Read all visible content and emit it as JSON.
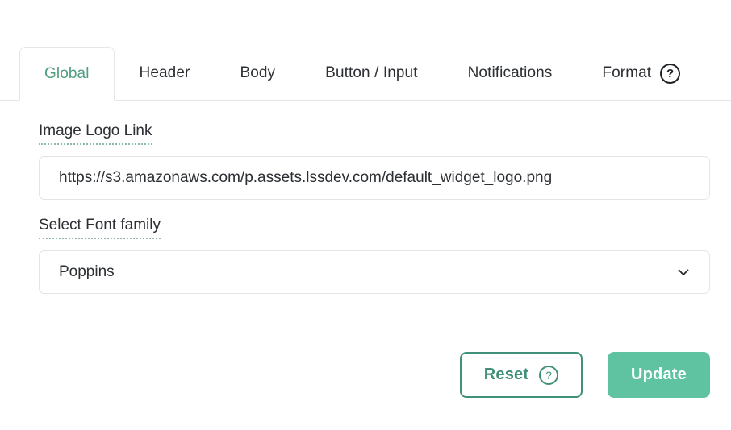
{
  "tabs": {
    "items": [
      {
        "label": "Global",
        "active": true
      },
      {
        "label": "Header",
        "active": false
      },
      {
        "label": "Body",
        "active": false
      },
      {
        "label": "Button / Input",
        "active": false
      },
      {
        "label": "Notifications",
        "active": false
      },
      {
        "label": "Format",
        "active": false
      }
    ],
    "help_icon": "question-mark-circle-icon",
    "help_glyph": "?"
  },
  "form": {
    "logo": {
      "label": "Image Logo Link",
      "value": "https://s3.amazonaws.com/p.assets.lssdev.com/default_widget_logo.png",
      "placeholder": "https://s3.amazonaws.com/p.assets.lssdev.com/default_widget_logo.png"
    },
    "font": {
      "label": "Select Font family",
      "value": "Poppins",
      "chevron_icon": "chevron-down-icon"
    }
  },
  "actions": {
    "reset": {
      "label": "Reset",
      "help_glyph": "?",
      "help_icon": "question-mark-circle-icon"
    },
    "update": {
      "label": "Update"
    }
  },
  "colors": {
    "accent_green": "#5fc2a1",
    "accent_green_dark": "#41917a",
    "active_tab_text": "#4f9e80",
    "border_gray": "#e2e5e8",
    "text_dark": "#2b2f33",
    "dotted_underline": "#8fb9ab"
  }
}
